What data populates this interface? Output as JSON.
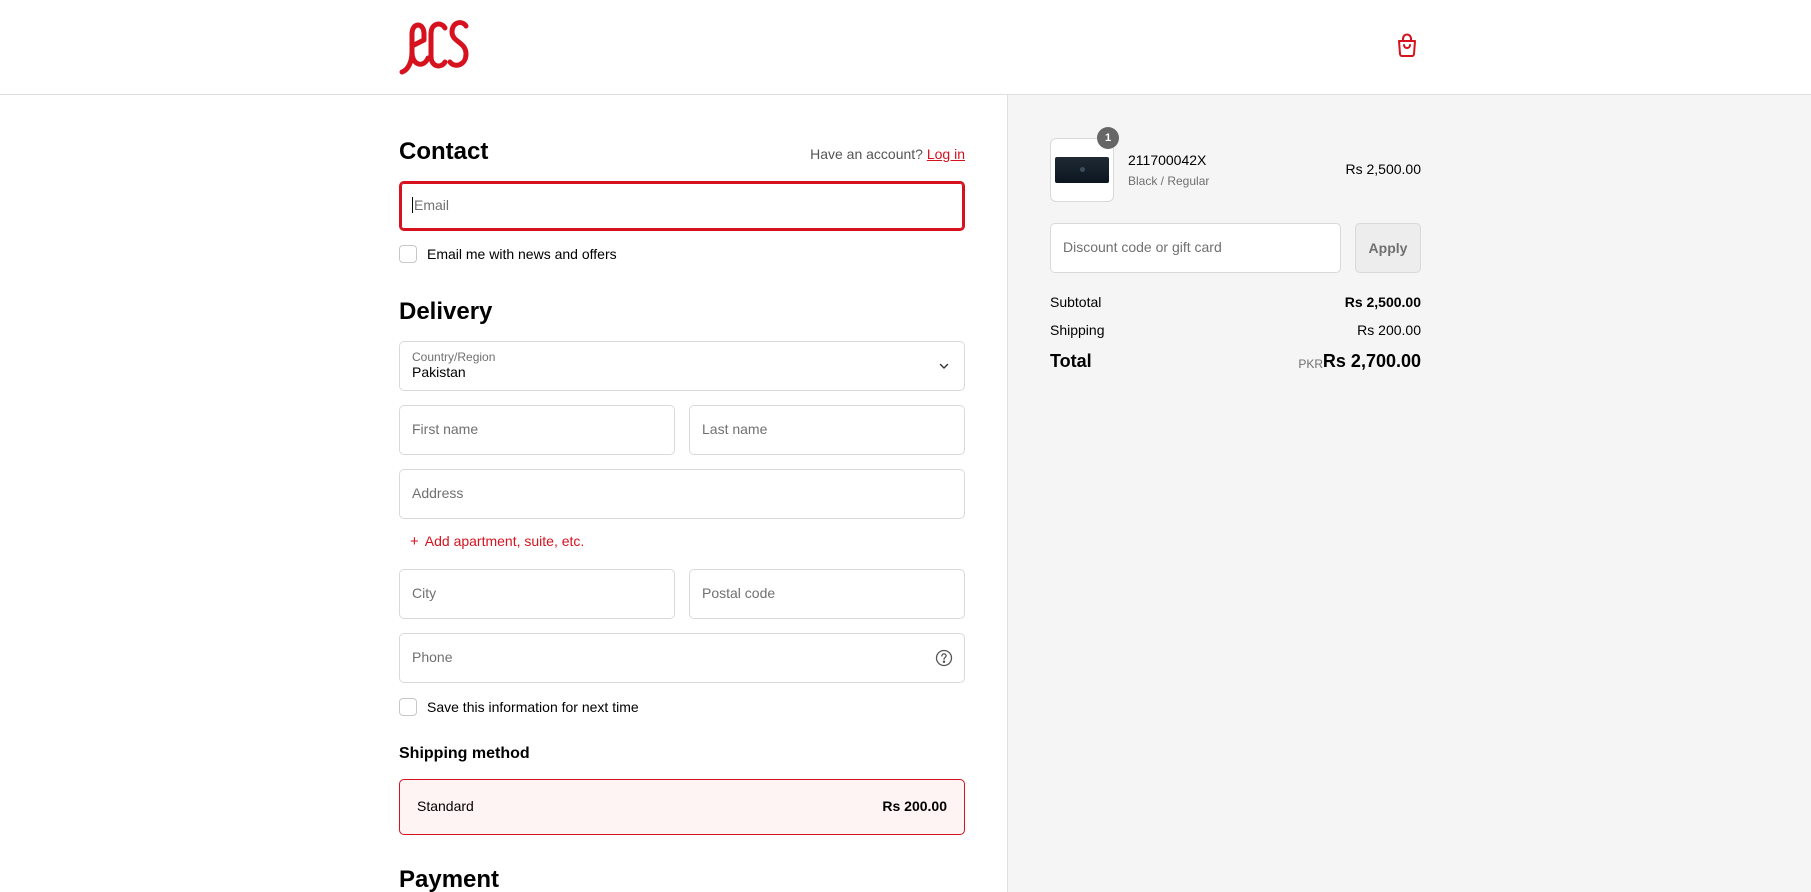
{
  "header": {
    "logo_text": "ecs"
  },
  "contact": {
    "title": "Contact",
    "have_account": "Have an account?",
    "login_link": "Log in",
    "email_placeholder": "Email",
    "news_checkbox_label": "Email me with news and offers"
  },
  "delivery": {
    "title": "Delivery",
    "country_label": "Country/Region",
    "country_value": "Pakistan",
    "first_name_placeholder": "First name",
    "last_name_placeholder": "Last name",
    "address_placeholder": "Address",
    "add_apartment": "Add apartment, suite, etc.",
    "city_placeholder": "City",
    "postal_placeholder": "Postal code",
    "phone_placeholder": "Phone",
    "save_info_label": "Save this information for next time"
  },
  "shipping": {
    "title": "Shipping method",
    "option_name": "Standard",
    "option_price": "Rs 200.00"
  },
  "payment": {
    "title": "Payment"
  },
  "summary": {
    "product": {
      "quantity": "1",
      "name": "211700042X",
      "variant": "Black / Regular",
      "price": "Rs 2,500.00"
    },
    "discount_placeholder": "Discount code or gift card",
    "apply_label": "Apply",
    "subtotal_label": "Subtotal",
    "subtotal_value": "Rs 2,500.00",
    "shipping_label": "Shipping",
    "shipping_value": "Rs 200.00",
    "total_label": "Total",
    "total_currency": "PKR",
    "total_value": "Rs 2,700.00"
  },
  "colors": {
    "brand_red": "#d6121f",
    "sidebar_bg": "#f5f5f5",
    "border": "#d9d9d9"
  },
  "icons": [
    "ecs-logo",
    "shopping-bag-icon",
    "chevron-down-icon",
    "help-circle-icon",
    "plus-icon"
  ]
}
